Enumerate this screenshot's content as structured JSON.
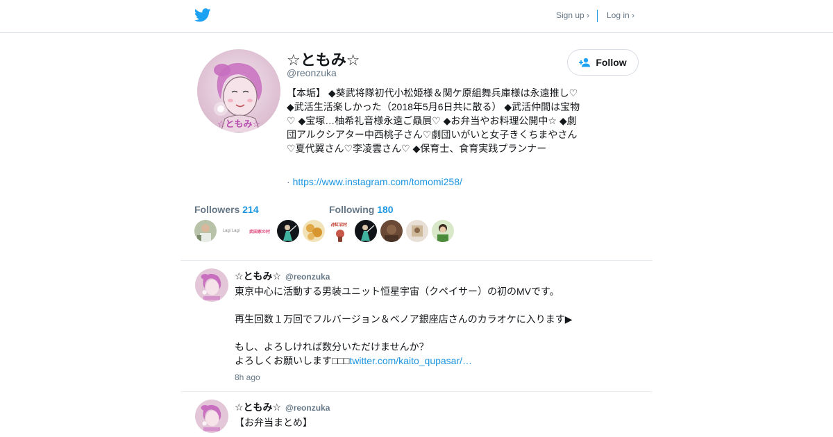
{
  "nav": {
    "signup": "Sign up ›",
    "login": "Log in ›"
  },
  "profile": {
    "name": "☆ともみ☆",
    "handle": "@reonzuka",
    "follow_label": "Follow",
    "bio": "【本垢】 ◆葵武将隊初代小松姫様＆関ケ原組舞兵庫様は永遠推し♡ ◆武活生活楽しかった（2018年5月6日共に散る） ◆武活仲間は宝物♡ ◆宝塚…柚希礼音様永遠ご贔屓♡ ◆お弁当やお料理公開中☆ ◆劇団アルクシアター中西桃子さん♡劇団いがいと女子きくちまやさん♡夏代翼さん♡李凌雲さん♡ ◆保育士、食育実践プランナー",
    "link_prefix": "·",
    "link": "https://www.instagram.com/tomomi258/",
    "avatar_text": "☆ともみ☆"
  },
  "stats": {
    "followers_label": "Followers",
    "followers_count": "214",
    "following_label": "Following",
    "following_count": "180",
    "follower_mini_text": [
      "Lagi Lagi",
      "武田家の村"
    ],
    "following_mini_text": [
      "特紅沼村"
    ]
  },
  "tweets": [
    {
      "name": "☆ともみ☆",
      "handle": "@reonzuka",
      "line1": "東京中心に活動する男装ユニット恒星宇宙（クペイサー）の初のMVです。",
      "line2": "再生回数１万回でフルバージョン＆ベノア銀座店さんのカラオケに入ります▶",
      "line3": "もし、よろしければ数分いただけませんか？",
      "line4_text": "よろしくお願いします□□□",
      "line4_link": "twitter.com/kaito_qupasar/…",
      "time": "8h ago"
    },
    {
      "name": "☆ともみ☆",
      "handle": "@reonzuka",
      "line1": "【お弁当まとめ】"
    }
  ],
  "colors": {
    "brand_blue": "#1da1f2",
    "link_blue": "#1b95e0",
    "muted": "#657786",
    "avatar_pink": "#e9cfe0"
  },
  "icons": {
    "logo": "twitter-bird-icon",
    "follow": "person-add-icon"
  }
}
